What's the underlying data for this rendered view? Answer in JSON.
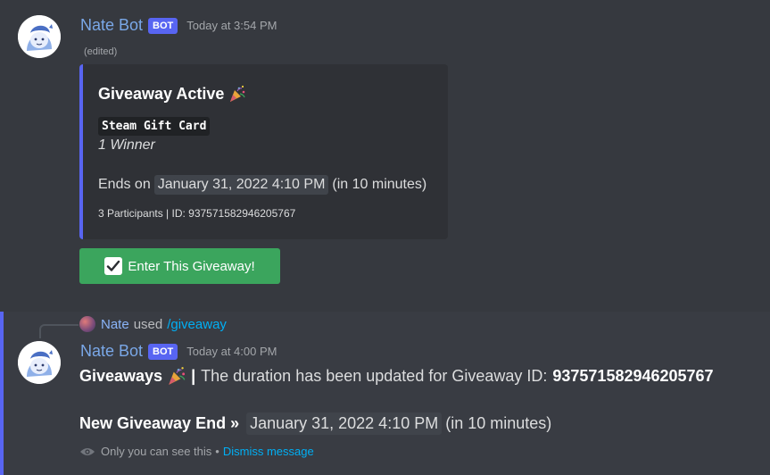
{
  "message1": {
    "author": "Nate Bot",
    "bot_tag": "BOT",
    "timestamp": "Today at 3:54 PM",
    "edited": "(edited)",
    "embed": {
      "title": "Giveaway Active",
      "title_emoji": "party-popper-icon",
      "prize": "Steam Gift Card",
      "winners": "1 Winner",
      "ends_label": "Ends on",
      "ends_date": "January 31, 2022 4:10 PM",
      "ends_relative": "(in 10 minutes)",
      "footer": "3 Participants | ID: 937571582946205767",
      "accent_color": "#5865f2"
    },
    "button": {
      "label": "Enter This Giveaway!",
      "icon": "check-icon",
      "color": "#3ba55d"
    }
  },
  "message2": {
    "reply_user": "Nate",
    "reply_used": "used",
    "reply_command": "/giveaway",
    "author": "Nate Bot",
    "bot_tag": "BOT",
    "timestamp": "Today at 4:00 PM",
    "line1_bold": "Giveaways",
    "line1_separator": "|",
    "line1_text": "The duration has been updated for Giveaway ID:",
    "line1_id": "937571582946205767",
    "line2_bold": "New Giveaway End »",
    "line2_date": "January 31, 2022 4:10 PM",
    "line2_relative": "(in 10 minutes)",
    "ephemeral_text": "Only you can see this",
    "ephemeral_dot": "•",
    "dismiss": "Dismiss message"
  }
}
